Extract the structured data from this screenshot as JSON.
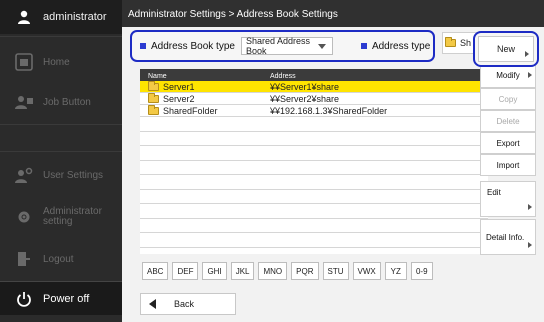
{
  "sidebar": {
    "user": "administrator",
    "items": [
      {
        "label": "Home",
        "icon": "home-icon"
      },
      {
        "label": "Job Button",
        "icon": "job-button-icon"
      },
      {
        "label": "User Settings",
        "icon": "user-settings-icon"
      },
      {
        "label": "Administrator setting",
        "icon": "admin-settings-icon"
      },
      {
        "label": "Logout",
        "icon": "logout-icon"
      }
    ],
    "power": "Power off"
  },
  "breadcrumb": "Administrator Settings > Address Book Settings",
  "filter": {
    "book_type_label": "Address Book type",
    "book_type_value": "Shared Address Book",
    "address_type_label": "Address type",
    "shared_value": "Sh"
  },
  "table": {
    "columns": [
      "Name",
      "Address"
    ],
    "rows": [
      {
        "name": "Server1",
        "address": "¥¥Server1¥share",
        "selected": true
      },
      {
        "name": "Server2",
        "address": "¥¥Server2¥share",
        "selected": false
      },
      {
        "name": "SharedFolder",
        "address": "¥¥192.168.1.3¥SharedFolder",
        "selected": false
      }
    ]
  },
  "alpha_tabs": [
    "ABC",
    "DEF",
    "GHI",
    "JKL",
    "MNO",
    "PQR",
    "STU",
    "VWX",
    "YZ",
    "0-9"
  ],
  "back": "Back",
  "actions": {
    "new": "New",
    "modify": "Modify",
    "copy": "Copy",
    "delete": "Delete",
    "export": "Export",
    "import": "Import",
    "edit": "Edit",
    "detail": "Detail Info."
  },
  "colors": {
    "accent": "#1d2bc4",
    "selected_row": "#ffe400",
    "sidebar_bg": "#2b2b2b"
  }
}
